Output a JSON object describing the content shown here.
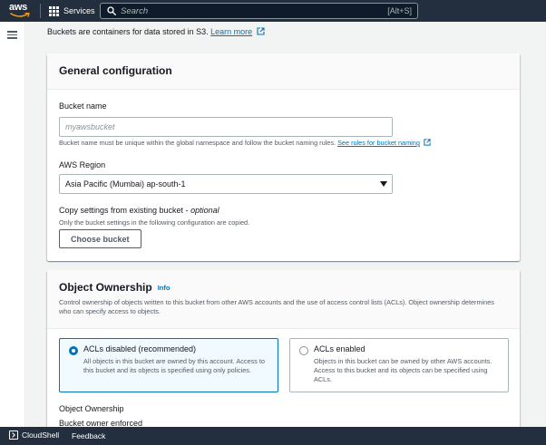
{
  "topnav": {
    "logo_text": "aws",
    "services_label": "Services",
    "search_placeholder": "Search",
    "search_shortcut": "[Alt+S]"
  },
  "description": {
    "text": "Buckets are containers for data stored in S3.",
    "link_label": "Learn more"
  },
  "general_configuration": {
    "title": "General configuration",
    "bucket_name_label": "Bucket name",
    "bucket_name_placeholder": "myawsbucket",
    "bucket_name_value": "",
    "bucket_name_hint": "Bucket name must be unique within the global namespace and follow the bucket naming rules.",
    "bucket_name_hint_link": "See rules for bucket naming",
    "region_label": "AWS Region",
    "region_value": "Asia Pacific (Mumbai) ap-south-1",
    "copy_label": "Copy settings from existing bucket - ",
    "copy_label_optional": "optional",
    "copy_hint": "Only the bucket settings in the following configuration are copied.",
    "choose_bucket_label": "Choose bucket"
  },
  "object_ownership": {
    "title": "Object Ownership",
    "info_label": "Info",
    "description": "Control ownership of objects written to this bucket from other AWS accounts and the use of access control lists (ACLs). Object ownership determines who can specify access to objects.",
    "options": [
      {
        "label": "ACLs disabled (recommended)",
        "description": "All objects in this bucket are owned by this account. Access to this bucket and its objects is specified using only policies.",
        "selected": true
      },
      {
        "label": "ACLs enabled",
        "description": "Objects in this bucket can be owned by other AWS accounts. Access to this bucket and its objects can be specified using ACLs.",
        "selected": false
      }
    ],
    "ownership_label": "Object Ownership",
    "ownership_value": "Bucket owner enforced"
  },
  "bottombar": {
    "cloudshell_label": "CloudShell",
    "feedback_label": "Feedback"
  },
  "colors": {
    "nav_bg": "#232f3e",
    "accent": "#0073bb",
    "logo_smile": "#ff9900"
  }
}
